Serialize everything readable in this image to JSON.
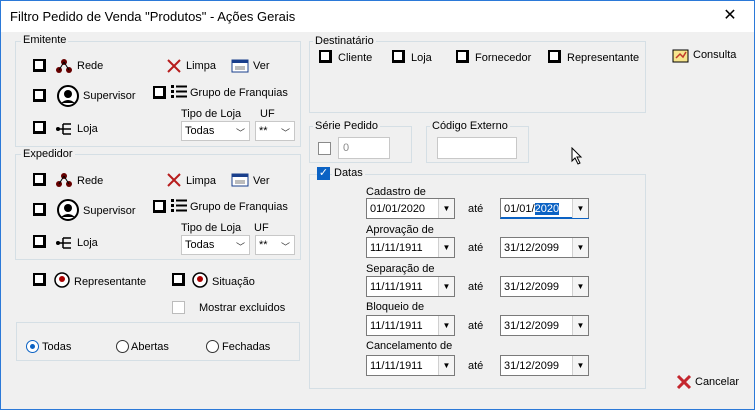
{
  "window": {
    "title": "Filtro Pedido de Venda \"Produtos\" - Ações Gerais",
    "close": "✕"
  },
  "emitente": {
    "label": "Emitente",
    "rede": "Rede",
    "supervisor": "Supervisor",
    "loja": "Loja",
    "limpa": "Limpa",
    "ver": "Ver",
    "grupo": "Grupo de Franquias",
    "tipo_loja_label": "Tipo de Loja",
    "tipo_loja_value": "Todas",
    "uf_label": "UF",
    "uf_value": "**"
  },
  "expedidor": {
    "label": "Expedidor",
    "rede": "Rede",
    "supervisor": "Supervisor",
    "loja": "Loja",
    "limpa": "Limpa",
    "ver": "Ver",
    "grupo": "Grupo de Franquias",
    "tipo_loja_label": "Tipo de Loja",
    "tipo_loja_value": "Todas",
    "uf_label": "UF",
    "uf_value": "**"
  },
  "filters": {
    "representante": "Representante",
    "situacao": "Situação",
    "mostrar_excluidos": "Mostrar excluidos"
  },
  "status": {
    "todas": "Todas",
    "abertas": "Abertas",
    "fechadas": "Fechadas",
    "selected": "todas"
  },
  "destinatario": {
    "label": "Destinatário",
    "cliente": "Cliente",
    "loja": "Loja",
    "fornecedor": "Fornecedor",
    "representante": "Representante"
  },
  "serie": {
    "label": "Série Pedido",
    "value": "0"
  },
  "codigo": {
    "label": "Código Externo",
    "value": ""
  },
  "datas": {
    "label": "Datas",
    "checked": true,
    "ate": "até",
    "rows": [
      {
        "label": "Cadastro de",
        "from": "01/01/2020",
        "to_prefix": "01/01/",
        "to_sel": "2020"
      },
      {
        "label": "Aprovação de",
        "from": "11/11/1911",
        "to": "31/12/2099"
      },
      {
        "label": "Separação de",
        "from": "11/11/1911",
        "to": "31/12/2099"
      },
      {
        "label": "Bloqueio de",
        "from": "11/11/1911",
        "to": "31/12/2099"
      },
      {
        "label": "Cancelamento de",
        "from": "11/11/1911",
        "to": "31/12/2099"
      }
    ]
  },
  "actions": {
    "consulta": "Consulta",
    "cancelar": "Cancelar"
  },
  "icons": {
    "network": "network-icon",
    "person": "person-icon",
    "tree": "tree-icon",
    "clear": "clear-x-icon",
    "view": "view-window-icon",
    "list": "list-icon",
    "cursor": "mouse-cursor-icon",
    "search": "consulta-icon",
    "cancel": "cancel-x-icon"
  },
  "colors": {
    "accent": "#0b62c4",
    "cancel_red": "#c4262e",
    "window_border": "#2b79d8"
  }
}
